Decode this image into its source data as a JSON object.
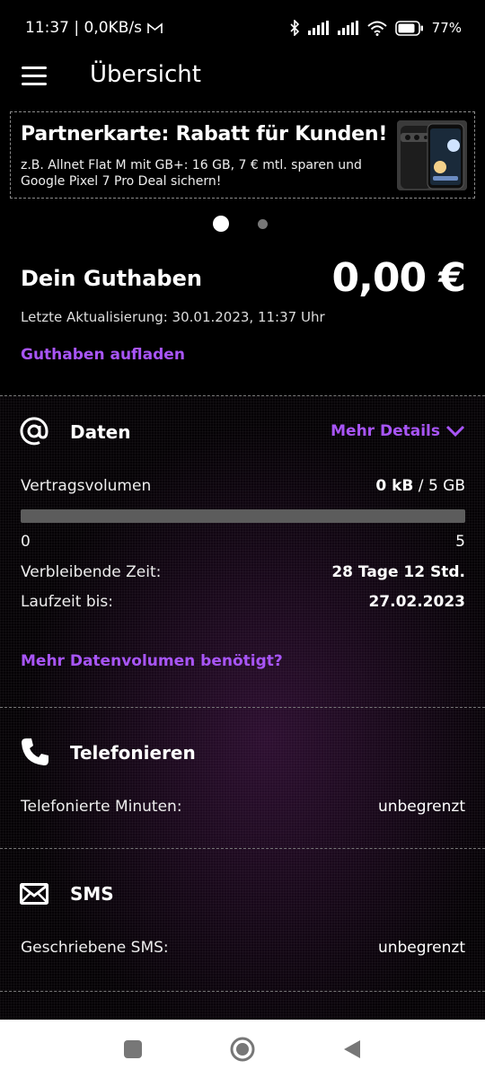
{
  "status_bar": {
    "time_speed": "11:37 | 0,0KB/s",
    "battery": "77%"
  },
  "app_bar": {
    "title": "Übersicht"
  },
  "banner": {
    "title": "Partnerkarte: Rabatt für Kunden!",
    "text": "z.B. Allnet Flat M mit GB+: 16 GB, 7 € mtl. sparen und Google Pixel 7 Pro Deal sichern!"
  },
  "carousel": {
    "active_index": 0,
    "count": 2
  },
  "balance": {
    "label": "Dein Guthaben",
    "value": "0,00 €",
    "updated": "Letzte Aktualisierung: 30.01.2023, 11:37 Uhr",
    "topup_link": "Guthaben aufladen"
  },
  "data": {
    "title": "Daten",
    "details_link": "Mehr Details",
    "volume_label": "Vertragsvolumen",
    "volume_used": "0 kB",
    "volume_sep": "/",
    "volume_total": "5 GB",
    "progress_fraction": 0,
    "scale_min": "0",
    "scale_max": "5",
    "remaining_label": "Verbleibende Zeit:",
    "remaining_value": "28 Tage 12 Std.",
    "runtime_label": "Laufzeit bis:",
    "runtime_value": "27.02.2023",
    "more_link": "Mehr Datenvolumen benötigt?"
  },
  "calls": {
    "title": "Telefonieren",
    "label": "Telefonierte Minuten:",
    "value": "unbegrenzt"
  },
  "sms": {
    "title": "SMS",
    "label": "Geschriebene SMS:",
    "value": "unbegrenzt"
  },
  "colors": {
    "accent": "#a855f7",
    "background": "#000000",
    "progress_track": "#5c5c5c"
  },
  "icons": {
    "mail": "gmail-icon",
    "bluetooth": "bluetooth-icon",
    "signal": "signal-icon",
    "wifi": "wifi-icon",
    "battery": "battery-icon",
    "menu": "menu-icon",
    "at": "at-icon",
    "chevron": "chevron-down-icon",
    "phone": "phone-icon",
    "envelope": "envelope-icon"
  }
}
